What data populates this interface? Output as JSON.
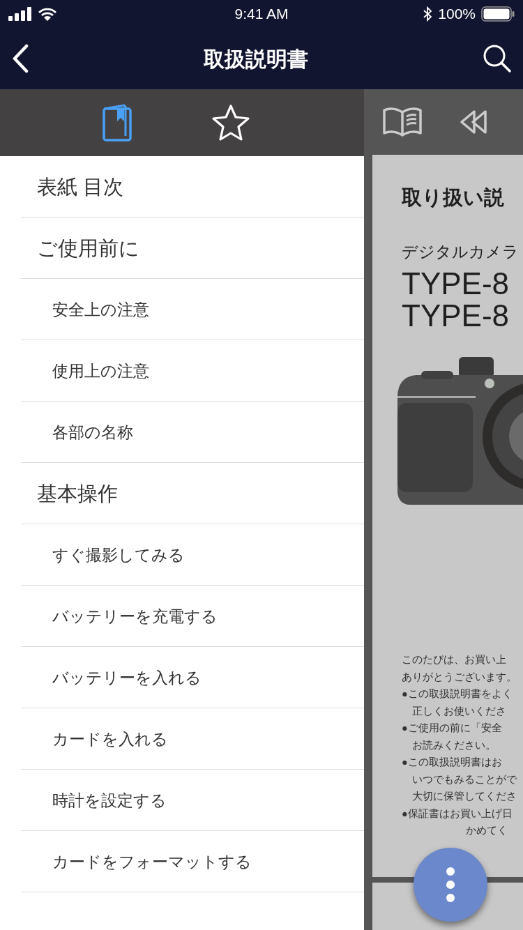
{
  "status_bar": {
    "time": "9:41 AM",
    "battery": "100%"
  },
  "nav_bar": {
    "title": "取扱説明書"
  },
  "sidebar": {
    "tabs": [
      {
        "kind": "contents",
        "selected": true
      },
      {
        "kind": "bookmarks",
        "selected": false
      }
    ],
    "items": [
      {
        "label": "表紙 目次"
      },
      {
        "label": "ご使用前に",
        "children": [
          {
            "label": "安全上の注意"
          },
          {
            "label": "使用上の注意"
          },
          {
            "label": "各部の名称"
          }
        ]
      },
      {
        "label": "基本操作",
        "children": [
          {
            "label": "すぐ撮影してみる"
          },
          {
            "label": "バッテリーを充電する"
          },
          {
            "label": "バッテリーを入れる"
          },
          {
            "label": "カードを入れる"
          },
          {
            "label": "時計を設定する"
          },
          {
            "label": "カードをフォーマットする"
          }
        ]
      }
    ]
  },
  "document": {
    "heading": "取り扱い説",
    "subtitle": "デジタルカメラ",
    "models": [
      "TYPE-8",
      "TYPE-8"
    ],
    "lines": [
      {
        "kind": "plain",
        "text": "このたびは、お買い上"
      },
      {
        "kind": "plain",
        "text": "ありがとうございます。"
      },
      {
        "kind": "bullet",
        "text": "●この取扱説明書をよく"
      },
      {
        "kind": "cont",
        "text": "正しくお使いくださ"
      },
      {
        "kind": "bullet",
        "text": "●ご使用の前に「安全"
      },
      {
        "kind": "cont",
        "text": "お読みください。"
      },
      {
        "kind": "bullet",
        "text": "●この取扱説明書はお"
      },
      {
        "kind": "cont",
        "text": "いつでもみることがで"
      },
      {
        "kind": "cont",
        "text": "大切に保管してくださ"
      },
      {
        "kind": "bullet",
        "text": "●保証書はお買い上げ日"
      },
      {
        "kind": "covered",
        "text": "かめてく"
      }
    ]
  }
}
